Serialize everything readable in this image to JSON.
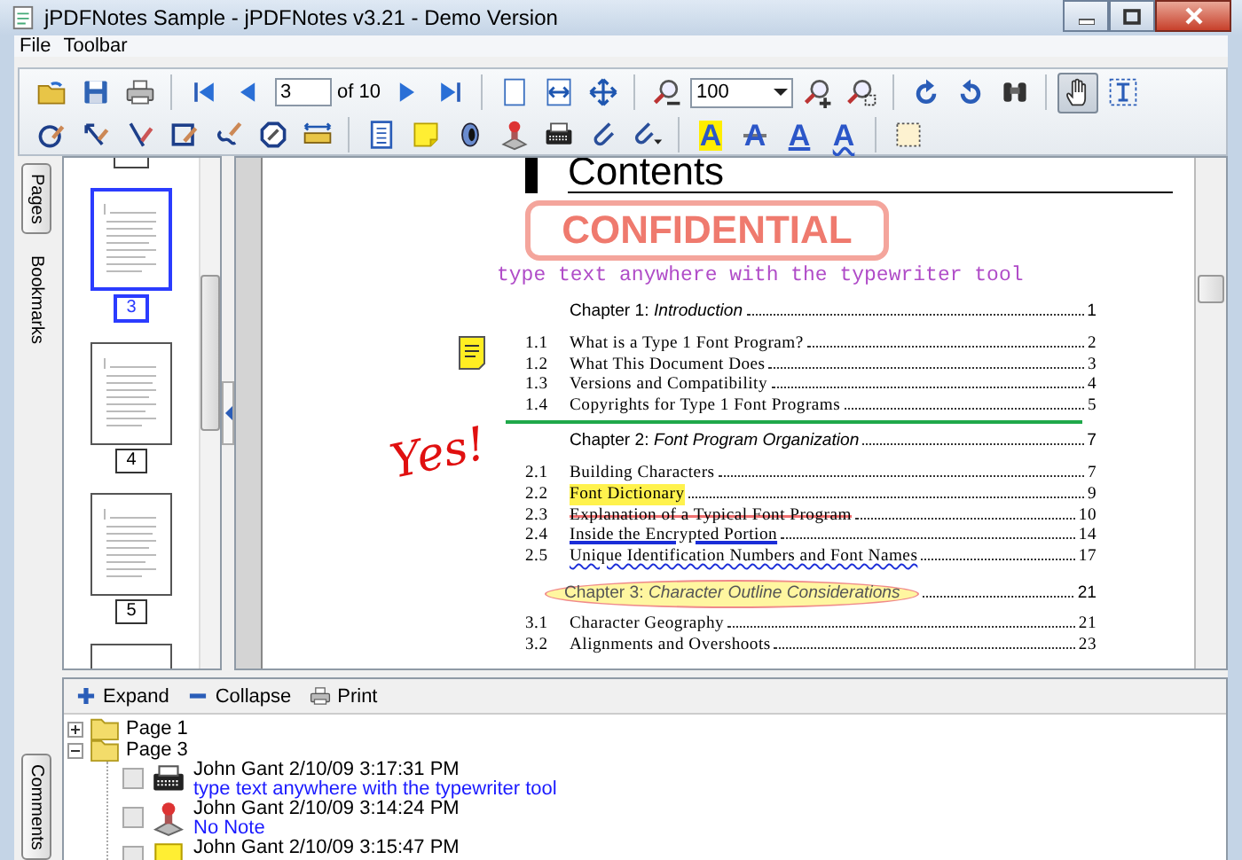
{
  "window": {
    "title": "jPDFNotes Sample - jPDFNotes v3.21 - Demo Version"
  },
  "menu": [
    "File",
    "Toolbar"
  ],
  "toolbar": {
    "rows": [
      {
        "items": [
          {
            "kind": "folder",
            "selected": false
          },
          {
            "kind": "floppy",
            "selected": false
          },
          {
            "kind": "printer",
            "selected": false
          },
          {
            "kind": "separator"
          },
          {
            "kind": "first",
            "selected": false
          },
          {
            "kind": "prev",
            "selected": false
          },
          {
            "kind": "field",
            "value": "3"
          },
          {
            "kind": "label",
            "text": "of 10"
          },
          {
            "kind": "next",
            "selected": false
          },
          {
            "kind": "last",
            "selected": false
          },
          {
            "kind": "separator"
          },
          {
            "kind": "fitpage",
            "selected": false
          },
          {
            "kind": "fitwidth",
            "selected": false
          },
          {
            "kind": "fitall",
            "selected": false
          },
          {
            "kind": "separator"
          },
          {
            "kind": "zoomout",
            "selected": false
          },
          {
            "kind": "combo",
            "value": "100"
          },
          {
            "kind": "zoomin",
            "selected": false
          },
          {
            "kind": "zoomarea",
            "selected": false
          },
          {
            "kind": "separator"
          },
          {
            "kind": "rotleft",
            "selected": false
          },
          {
            "kind": "rotright",
            "selected": false
          },
          {
            "kind": "binoculars",
            "selected": false
          },
          {
            "kind": "separator"
          },
          {
            "kind": "hand",
            "selected": true
          },
          {
            "kind": "textselect",
            "selected": false
          }
        ]
      },
      {
        "items": [
          {
            "kind": "circle",
            "selected": false
          },
          {
            "kind": "arrow",
            "selected": false
          },
          {
            "kind": "line",
            "selected": false
          },
          {
            "kind": "rectangle",
            "selected": false
          },
          {
            "kind": "scribble",
            "selected": false
          },
          {
            "kind": "octagon",
            "selected": false
          },
          {
            "kind": "ruler",
            "selected": false
          },
          {
            "kind": "separator"
          },
          {
            "kind": "doclines",
            "selected": false
          },
          {
            "kind": "sticky",
            "selected": false
          },
          {
            "kind": "speaker",
            "selected": false
          },
          {
            "kind": "stamp",
            "selected": false
          },
          {
            "kind": "typewriter",
            "selected": false
          },
          {
            "kind": "paperclip",
            "selected": false
          },
          {
            "kind": "clipmenu",
            "selected": false
          },
          {
            "kind": "separator"
          },
          {
            "kind": "highlight",
            "glyph": "A",
            "selected": false
          },
          {
            "kind": "strikeout",
            "glyph": "A",
            "selected": false
          },
          {
            "kind": "underline",
            "glyph": "A",
            "selected": false
          },
          {
            "kind": "squiggly",
            "glyph": "A",
            "selected": false
          },
          {
            "kind": "separator"
          },
          {
            "kind": "areaselect",
            "selected": false
          }
        ]
      }
    ]
  },
  "side_tabs": [
    {
      "label": "Pages",
      "selected": true
    },
    {
      "label": "Bookmarks",
      "selected": false
    }
  ],
  "thumbnails": [
    {
      "label": "3",
      "selected": true
    },
    {
      "label": "4",
      "selected": false
    },
    {
      "label": "5",
      "selected": false
    }
  ],
  "document": {
    "heading": "Contents",
    "stamp": "CONFIDENTIAL",
    "typewriter_text": "type text anywhere with the typewriter tool",
    "ink": "Yes!",
    "items": [
      {
        "kind": "chapter",
        "title": "Chapter 1: *Introduction*",
        "page": "1"
      },
      {
        "kind": "section",
        "number": "1.1",
        "title": "What is a Type 1 Font Program?",
        "page": "2"
      },
      {
        "kind": "section",
        "number": "1.2",
        "title": "What This Document Does",
        "page": "3"
      },
      {
        "kind": "section",
        "number": "1.3",
        "title": "Versions and Compatibility",
        "page": "4"
      },
      {
        "kind": "section",
        "number": "1.4",
        "title": "Copyrights for Type 1 Font Programs",
        "page": "5"
      },
      {
        "kind": "line"
      },
      {
        "kind": "chapter",
        "title": "Chapter 2: *Font Program Organization*",
        "page": "7"
      },
      {
        "kind": "section",
        "number": "2.1",
        "title": "Building Characters",
        "page": "7"
      },
      {
        "kind": "highlighted",
        "number": "2.2",
        "title": "Font Dictionary",
        "page": "9"
      },
      {
        "kind": "struck",
        "number": "2.3",
        "title": "Explanation of a Typical Font Program",
        "page": "10"
      },
      {
        "kind": "underlined",
        "number": "2.4",
        "title": "Inside the Encrypted Portion",
        "page": "14"
      },
      {
        "kind": "squiggled",
        "number": "2.5",
        "title": "Unique Identification Numbers and Font Names",
        "page": "17"
      },
      {
        "kind": "circled",
        "title": "Chapter 3: *Character Outline Considerations*",
        "page": "21"
      },
      {
        "kind": "section",
        "number": "3.1",
        "title": "Character Geography",
        "page": "21"
      },
      {
        "kind": "section",
        "number": "3.2",
        "title": "Alignments and Overshoots",
        "page": "23"
      }
    ]
  },
  "comments": {
    "tab": {
      "label": "Comments",
      "selected": true
    },
    "buttons": [
      {
        "kind": "expand",
        "label": "Expand"
      },
      {
        "kind": "collapse",
        "label": "Collapse"
      },
      {
        "kind": "print",
        "label": "Print"
      }
    ],
    "tree": [
      {
        "label": "Page 1",
        "expanded": false
      },
      {
        "label": "Page 3",
        "expanded": true,
        "children": [
          {
            "kind": "typewriter",
            "author": "John Gant 2/10/09 3:17:31 PM",
            "note": "type text anywhere with the typewriter tool",
            "checked": false
          },
          {
            "kind": "stamp",
            "author": "John Gant 2/10/09 3:14:24 PM",
            "note": "No Note",
            "checked": false
          },
          {
            "kind": "sticky",
            "author": "John Gant 2/10/09 3:15:47 PM",
            "checked": false
          }
        ]
      }
    ]
  }
}
